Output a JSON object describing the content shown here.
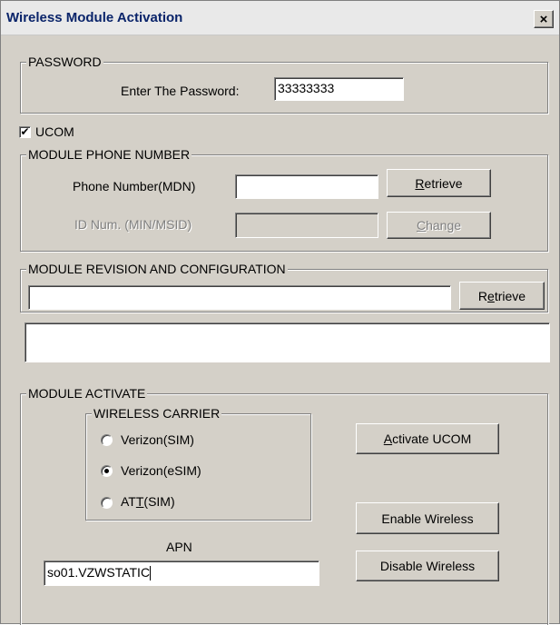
{
  "window": {
    "title": "Wireless Module Activation",
    "close_label": "×"
  },
  "password_group": {
    "title": "PASSWORD",
    "label": "Enter The Password:",
    "value": "33333333"
  },
  "ucom_checkbox": {
    "checked": true,
    "check_glyph": "✔",
    "label": "UCOM"
  },
  "phone_group": {
    "title": "MODULE PHONE NUMBER",
    "phone_label": "Phone Number(MDN)",
    "phone_value": "",
    "id_label": "ID Num. (MIN/MSID)",
    "id_value": "",
    "retrieve_button": {
      "mnemonic": "R",
      "rest": "etrieve"
    },
    "change_button": {
      "mnemonic": "C",
      "rest": "hange"
    }
  },
  "revision_group": {
    "title": "MODULE REVISION AND CONFIGURATION",
    "value": "",
    "retrieve_button": {
      "prefix": "R",
      "mnemonic": "e",
      "rest": "trieve"
    }
  },
  "info_box": {
    "value": ""
  },
  "activate_group": {
    "title": "MODULE ACTIVATE",
    "carrier_group": {
      "title": "WIRELESS CARRIER",
      "options": [
        {
          "label": "Verizon(SIM)",
          "checked": false
        },
        {
          "label": "Verizon(eSIM)",
          "checked": true
        },
        {
          "label_prefix": "AT",
          "label_mnemonic": "T",
          "label_suffix": "(SIM)",
          "checked": false
        }
      ]
    },
    "activate_button": {
      "mnemonic": "A",
      "rest": "ctivate UCOM"
    },
    "enable_button": "Enable Wireless",
    "disable_button": "Disable Wireless",
    "apn_label": "APN",
    "apn_value": "so01.VZWSTATIC"
  }
}
